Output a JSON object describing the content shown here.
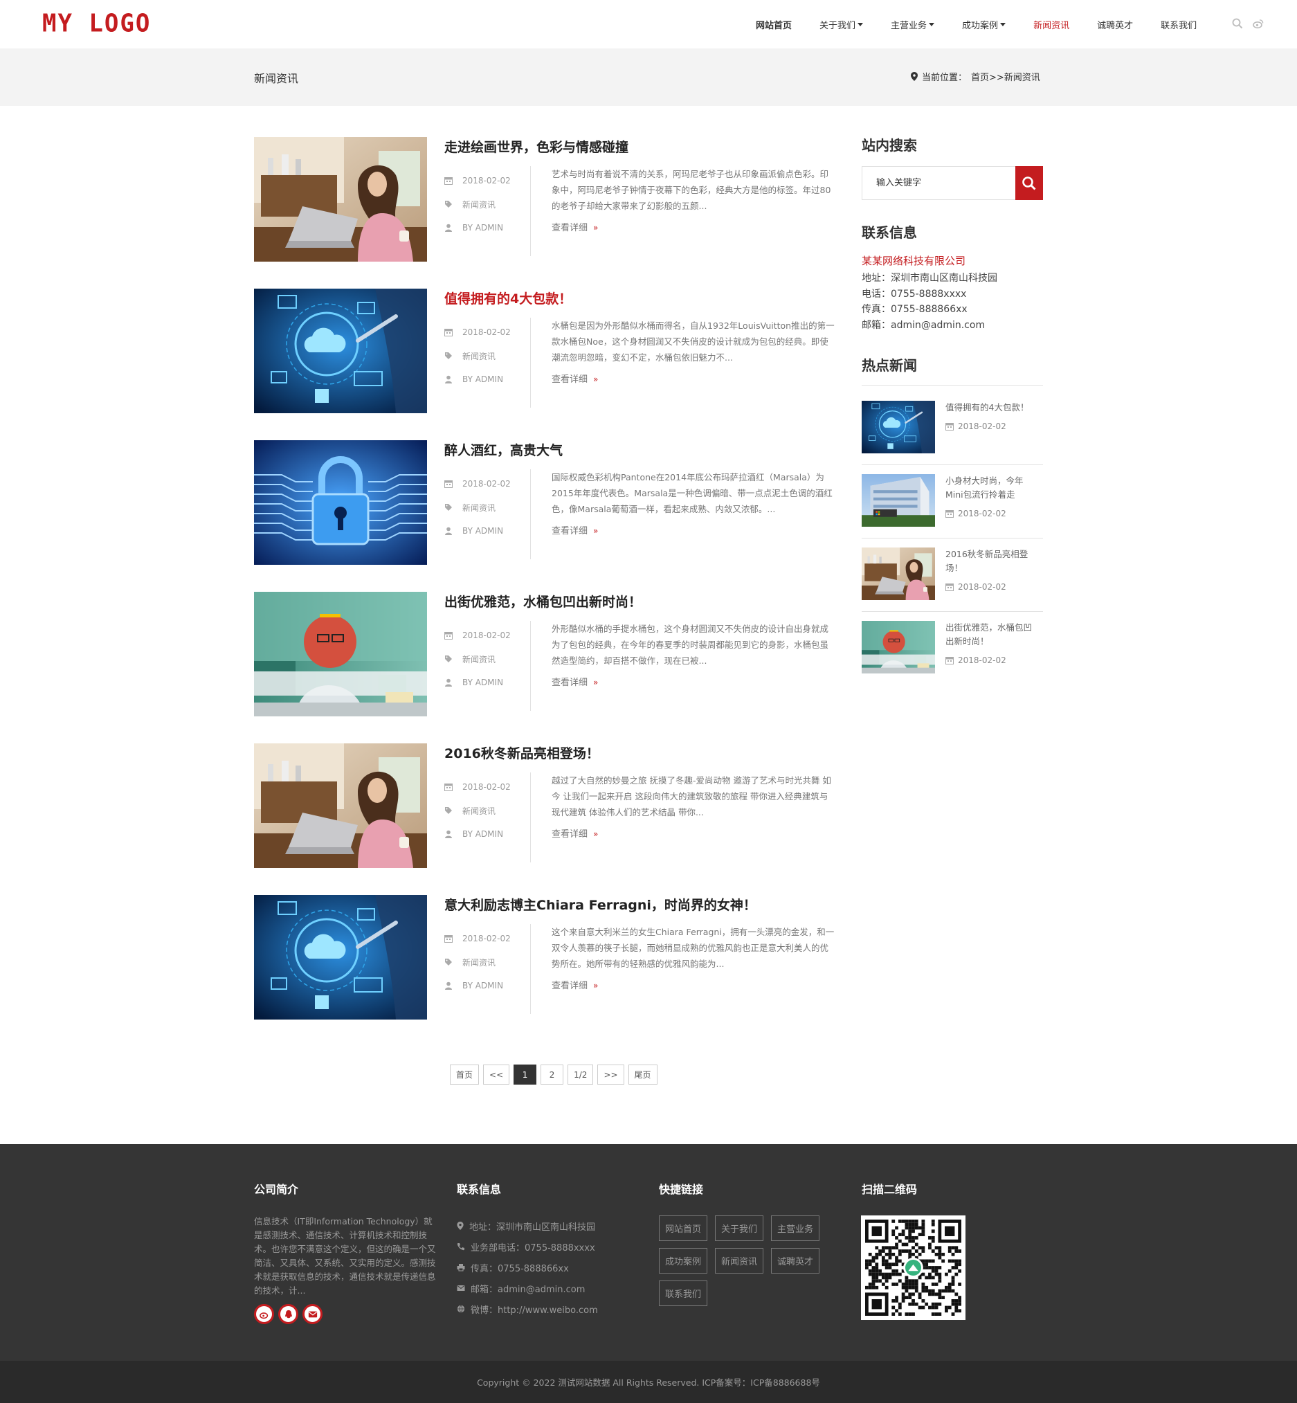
{
  "header": {
    "logo": "MY LOGO",
    "nav": [
      {
        "label": "网站首页",
        "caret": false
      },
      {
        "label": "关于我们",
        "caret": true
      },
      {
        "label": "主营业务",
        "caret": true
      },
      {
        "label": "成功案例",
        "caret": true
      },
      {
        "label": "新闻资讯",
        "caret": false
      },
      {
        "label": "诚聘英才",
        "caret": false
      },
      {
        "label": "联系我们",
        "caret": false
      }
    ],
    "icons": [
      "search-icon",
      "weibo-icon"
    ]
  },
  "banner": {
    "title": "新闻资讯",
    "crumb_prefix": "当前位置：",
    "crumb_path": "首页>>新闻资讯"
  },
  "articles": [
    {
      "title": "走进绘画世界，色彩与情感碰撞",
      "date": "2018-02-02",
      "category": "新闻资讯",
      "author": "BY ADMIN",
      "summary": "艺术与时尚有着说不清的关系，阿玛尼老爷子也从印象画派偷点色彩。印象中，阿玛尼老爷子钟情于夜幕下的色彩，经典大方是他的标签。年过80的老爷子却给大家带来了幻影般的五颜...",
      "more": "查看详细",
      "image": "woman-laptop"
    },
    {
      "title": "值得拥有的4大包款！",
      "date": "2018-02-02",
      "category": "新闻资讯",
      "author": "BY ADMIN",
      "summary": "水桶包是因为外形酷似水桶而得名，自从1932年LouisVuitton推出的第一款水桶包Noe，这个身材圆润又不失俏皮的设计就成为包包的经典。即使潮流忽明忽暗，变幻不定，水桶包依旧魅力不...",
      "more": "查看详细",
      "image": "cloud-tech"
    },
    {
      "title": "醉人酒红，高贵大气",
      "date": "2018-02-02",
      "category": "新闻资讯",
      "author": "BY ADMIN",
      "summary": "国际权威色彩机构Pantone在2014年底公布玛萨拉酒红（Marsala）为2015年年度代表色。Marsala是一种色调偏暗、带一点点泥土色调的酒红色，像Marsala葡萄酒一样，看起来成熟、内敛又浓郁。...",
      "more": "查看详细",
      "image": "padlock"
    },
    {
      "title": "出街优雅范，水桶包凹出新时尚！",
      "date": "2018-02-02",
      "category": "新闻资讯",
      "author": "BY ADMIN",
      "summary": "外形酷似水桶的手提水桶包，这个身材圆润又不失俏皮的设计自出身就成为了包包的经典，在今年的春夏季的时装周都能见到它的身影，水桶包虽然造型简约，却百搭不做作，现在已被...",
      "more": "查看详细",
      "image": "face-scan"
    },
    {
      "title": "2016秋冬新品亮相登场！",
      "date": "2018-02-02",
      "category": "新闻资讯",
      "author": "BY ADMIN",
      "summary": "越过了大自然的妙曼之旅 抚摸了冬趣-爱尚动物 邀游了艺术与时光共舞 如今 让我们一起来开启 这段向伟大的建筑致敬的旅程 带你进入经典建筑与现代建筑 体验伟人们的艺术结晶 带你...",
      "more": "查看详细",
      "image": "woman-laptop"
    },
    {
      "title": "意大利励志博主Chiara Ferragni，时尚界的女神！",
      "date": "2018-02-02",
      "category": "新闻资讯",
      "author": "BY ADMIN",
      "summary": "这个来自意大利米兰的女生Chiara Ferragni，拥有一头漂亮的金发，和一双令人羡慕的筷子长腿，而她稍显成熟的优雅风韵也正是意大利美人的优势所在。她所带有的轻熟感的优雅风韵能为...",
      "more": "查看详细",
      "image": "cloud-tech"
    }
  ],
  "pagination": [
    "首页",
    "<<",
    "1",
    "2",
    "1/2",
    ">>",
    "尾页"
  ],
  "pagination_current": "1",
  "sidebar": {
    "search_title": "站内搜索",
    "search_placeholder": "输入关键字",
    "contact_title": "联系信息",
    "company": "某某网络科技有限公司",
    "address": "地址：深圳市南山区南山科技园",
    "phone": "电话：0755-8888xxxx",
    "fax": "传真：0755-888866xx",
    "email": "邮箱：admin@admin.com",
    "hot_title": "热点新闻",
    "hot": [
      {
        "title": "值得拥有的4大包款！",
        "date": "2018-02-02",
        "image": "cloud-tech"
      },
      {
        "title": "小身材大时尚，今年Mini包流行拎着走",
        "date": "2018-02-02",
        "image": "building"
      },
      {
        "title": "2016秋冬新品亮相登场！",
        "date": "2018-02-02",
        "image": "woman-laptop"
      },
      {
        "title": "出街优雅范，水桶包凹出新时尚！",
        "date": "2018-02-02",
        "image": "face-scan"
      }
    ]
  },
  "footer": {
    "intro_title": "公司简介",
    "intro_text": "信息技术（IT即Information Technology）就是感测技术、通信技术、计算机技术和控制技术。也许您不满意这个定义，但这的确是一个又简洁、又具体、又系统、又实用的定义。感测技术就是获取信息的技术，通信技术就是传递信息的技术，计...",
    "contact_title": "联系信息",
    "contact": [
      {
        "icon": "map-marker-icon",
        "text": "地址：深圳市南山区南山科技园"
      },
      {
        "icon": "phone-icon",
        "text": "业务部电话：0755-8888xxxx"
      },
      {
        "icon": "printer-icon",
        "text": "传真：0755-888866xx"
      },
      {
        "icon": "envelope-icon",
        "text": "邮箱：admin@admin.com"
      },
      {
        "icon": "globe-icon",
        "text": "微博：http://www.weibo.com"
      }
    ],
    "links_title": "快捷链接",
    "links": [
      "网站首页",
      "关于我们",
      "主营业务",
      "成功案例",
      "新闻资讯",
      "诚聘英才",
      "联系我们"
    ],
    "qr_title": "扫描二维码",
    "social": [
      "weibo-icon",
      "qq-icon",
      "mail-icon"
    ],
    "copyright": "Copyright © 2022 测试网站数据 All Rights Reserved.   ICP备案号：ICP备8886688号"
  },
  "colors": {
    "accent": "#c41c1f",
    "footer_bg": "#353535",
    "copyright_bg": "#2a2a2a",
    "banner_bg": "#f3f3f3"
  }
}
